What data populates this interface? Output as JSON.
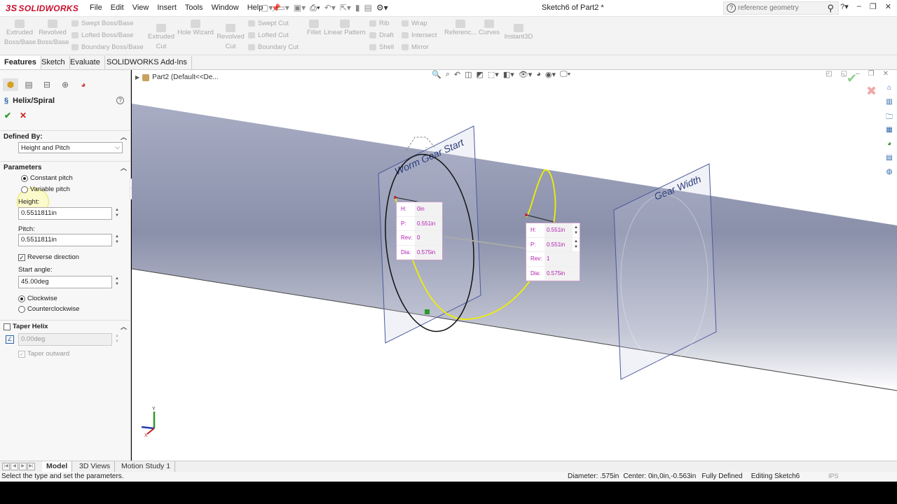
{
  "app": {
    "logo_prefix": "3S",
    "logo_text": "SOLIDWORKS",
    "menu": [
      "File",
      "Edit",
      "View",
      "Insert",
      "Tools",
      "Window",
      "Help"
    ],
    "document_title": "Sketch6 of Part2 *",
    "search_placeholder": "reference geometry"
  },
  "command_manager": {
    "large": [
      {
        "label": "Extruded Boss/Base"
      },
      {
        "label": "Revolved Boss/Base"
      },
      {
        "label": "Extruded Cut"
      },
      {
        "label": "Hole Wizard"
      },
      {
        "label": "Revolved Cut"
      },
      {
        "label": "Fillet"
      },
      {
        "label": "Linear Pattern"
      },
      {
        "label": "Referenc..."
      },
      {
        "label": "Curves"
      },
      {
        "label": "Instant3D"
      }
    ],
    "small": [
      "Swept Boss/Base",
      "Lofted Boss/Base",
      "Boundary Boss/Base",
      "Swept Cut",
      "Lofted Cut",
      "Boundary Cut",
      "Rib",
      "Draft",
      "Shell",
      "Wrap",
      "Intersect",
      "Mirror"
    ]
  },
  "tabs": [
    "Features",
    "Sketch",
    "Evaluate",
    "SOLIDWORKS Add-Ins"
  ],
  "property_manager": {
    "title": "Helix/Spiral",
    "help": "?",
    "defined_by": {
      "header": "Defined By:",
      "value": "Height and Pitch"
    },
    "parameters": {
      "header": "Parameters",
      "constant_pitch": "Constant pitch",
      "variable_pitch": "Variable pitch",
      "height_label": "Height:",
      "height_value": "0.5511811in",
      "pitch_label": "Pitch:",
      "pitch_value": "0.5511811in",
      "reverse_direction": "Reverse direction",
      "start_angle_label": "Start angle:",
      "start_angle_value": "45.00deg",
      "clockwise": "Clockwise",
      "counterclockwise": "Counterclockwise"
    },
    "taper": {
      "header": "Taper Helix",
      "angle_value": "0.00deg",
      "taper_outward": "Taper outward"
    }
  },
  "graphics": {
    "tree_item": "Part2  (Default<<De...",
    "plane1_label": "Worm Gear Start",
    "plane2_label": "Gear Width",
    "callout_start": [
      {
        "k": "H:",
        "v": "0in"
      },
      {
        "k": "P:",
        "v": "0.551in"
      },
      {
        "k": "Rev:",
        "v": "0"
      },
      {
        "k": "Dia:",
        "v": "0.575in"
      }
    ],
    "callout_end": [
      {
        "k": "H:",
        "v": "0.551in"
      },
      {
        "k": "P:",
        "v": "0.551in"
      },
      {
        "k": "Rev:",
        "v": "1"
      },
      {
        "k": "Dia:",
        "v": "0.575in"
      }
    ],
    "triad_x": "X",
    "triad_y": "Y"
  },
  "bottom_tabs": [
    "Model",
    "3D Views",
    "Motion Study 1"
  ],
  "status": {
    "message": "Select the type and set the parameters.",
    "diameter": "Diameter: .575in",
    "center": "Center: 0in,0in,-0.563in",
    "state": "Fully Defined",
    "editing": "Editing Sketch6",
    "units": "IPS"
  },
  "colors": {
    "accent_red": "#c8102e",
    "helix_yellow": "#f0f000",
    "callout_text": "#b020b0"
  }
}
